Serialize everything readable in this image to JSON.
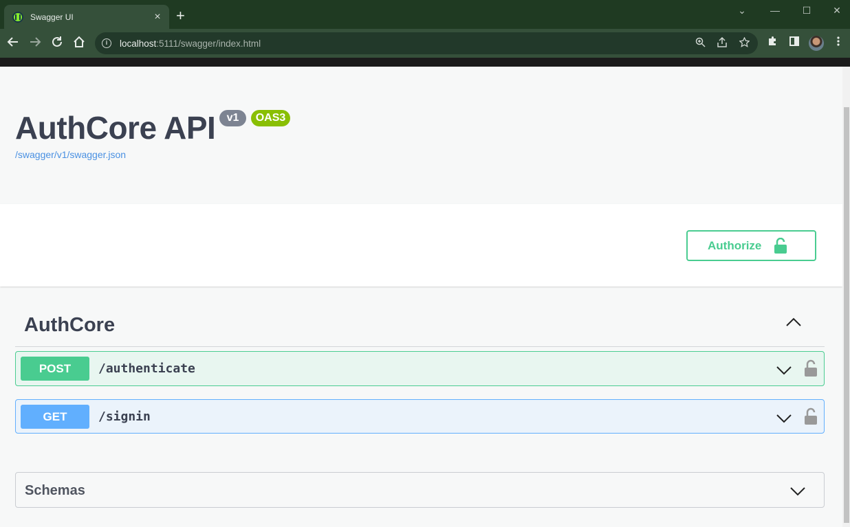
{
  "browser": {
    "tab_title": "Swagger UI",
    "tab_close": "×",
    "new_tab": "+",
    "url_host": "localhost",
    "url_path": ":5111/swagger/index.html",
    "window_controls": {
      "chevron": "⌄",
      "minimize": "—",
      "maximize": "☐",
      "close": "✕"
    }
  },
  "info": {
    "title": "AuthCore API",
    "version_badge": "v1",
    "oas_badge": "OAS3",
    "spec_link": "/swagger/v1/swagger.json"
  },
  "scheme": {
    "authorize_label": "Authorize"
  },
  "tag": {
    "name": "AuthCore",
    "operations": [
      {
        "method": "POST",
        "path": "/authenticate"
      },
      {
        "method": "GET",
        "path": "/signin"
      }
    ]
  },
  "schemas": {
    "title": "Schemas"
  },
  "colors": {
    "post": "#49cc90",
    "get": "#61affe",
    "text": "#3b4151",
    "badge_version": "#7d8492",
    "badge_oas": "#89bf04",
    "link": "#4990e2"
  },
  "icons": [
    "swagger-favicon",
    "back-arrow-icon",
    "forward-arrow-icon",
    "reload-icon",
    "home-icon",
    "site-info-icon",
    "zoom-icon",
    "share-icon",
    "star-icon",
    "extensions-icon",
    "side-panel-icon",
    "menu-icon",
    "unlock-icon",
    "lock-icon",
    "chevron-up-icon",
    "chevron-down-icon"
  ]
}
